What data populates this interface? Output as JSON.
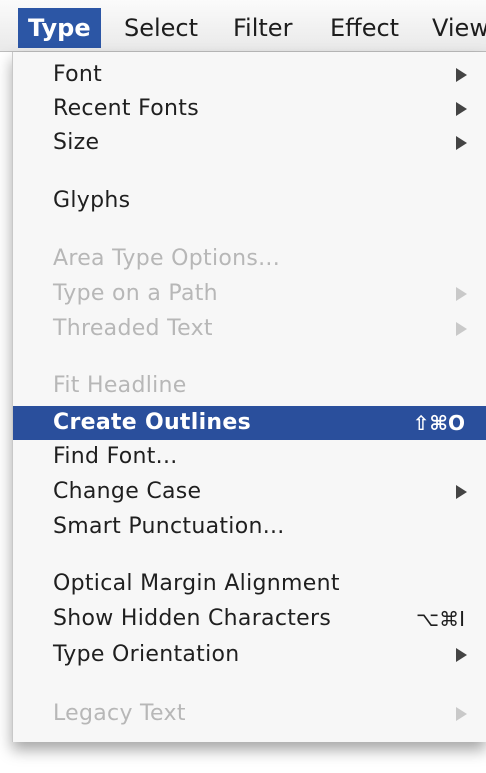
{
  "menubar": {
    "items": [
      {
        "label": "Type"
      },
      {
        "label": "Select"
      },
      {
        "label": "Filter"
      },
      {
        "label": "Effect"
      },
      {
        "label": "View"
      }
    ]
  },
  "menu": {
    "items": [
      {
        "label": "Font",
        "submenu": true,
        "enabled": true
      },
      {
        "label": "Recent Fonts",
        "submenu": true,
        "enabled": true
      },
      {
        "label": "Size",
        "submenu": true,
        "enabled": true
      },
      {
        "label": "Glyphs",
        "enabled": true
      },
      {
        "label": "Area Type Options...",
        "enabled": false
      },
      {
        "label": "Type on a Path",
        "submenu": true,
        "enabled": false
      },
      {
        "label": "Threaded Text",
        "submenu": true,
        "enabled": false
      },
      {
        "label": "Fit Headline",
        "enabled": false
      },
      {
        "label": "Create Outlines",
        "shortcut": "⇧⌘O",
        "enabled": true,
        "highlighted": true
      },
      {
        "label": "Find Font...",
        "enabled": true
      },
      {
        "label": "Change Case",
        "submenu": true,
        "enabled": true
      },
      {
        "label": "Smart Punctuation...",
        "enabled": true
      },
      {
        "label": "Optical Margin Alignment",
        "enabled": true
      },
      {
        "label": "Show Hidden Characters",
        "shortcut": "⌥⌘I",
        "enabled": true
      },
      {
        "label": "Type Orientation",
        "submenu": true,
        "enabled": true
      },
      {
        "label": "Legacy Text",
        "submenu": true,
        "enabled": false
      }
    ]
  },
  "colors": {
    "highlight": "#2a4f9c",
    "disabled_text": "#b7b7b7",
    "menu_bg": "#f7f7f7"
  }
}
